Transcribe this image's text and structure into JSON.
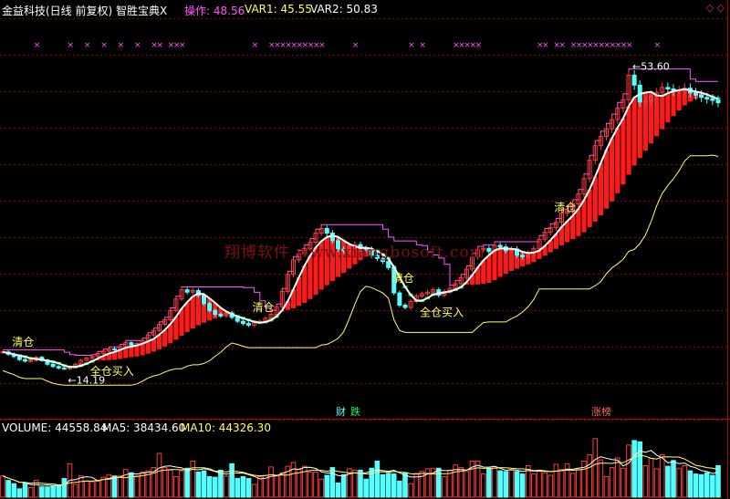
{
  "header": {
    "title": "金益科技(日线 前复权) 智胜宝典X",
    "op_label": "操作: 48.56",
    "var1_label": "VAR1: 45.55",
    "var2_label": "VAR2: 50.83",
    "corner_icons": "◇ ◇"
  },
  "watermark": "翔博软件 www.xiangbosoft.com",
  "volume_header": {
    "volume": "VOLUME: 44558.84",
    "ma5": "MA5: 38434.60",
    "ma10": "MA10: 44326.30"
  },
  "annotations": {
    "high": "53.60",
    "low": "14.19",
    "buy": "全仓买入",
    "clear": "清仓"
  },
  "event_badges": [
    "财",
    "跌",
    "涨榜"
  ],
  "colors": {
    "up": "#ff3c3c",
    "down": "#54ffff",
    "ma_white": "#ffffff",
    "support_yellow": "#ffff66",
    "resistance_magenta": "#ff55ff",
    "band_red": "#ff1a1a",
    "green_signal": "#00cc44",
    "ma10_yellow": "#ffff66",
    "grid": "#8b0000"
  },
  "chart_data": {
    "type": "candlestick",
    "price_close": [
      17.5,
      17.2,
      16.9,
      16.5,
      16.3,
      16.4,
      16.8,
      16.4,
      15.9,
      15.6,
      15.4,
      15.3,
      15.5,
      15.9,
      16.4,
      16.7,
      16.9,
      17.3,
      17.6,
      17.9,
      17.8,
      18.2,
      18.7,
      18.4,
      18.6,
      19.0,
      19.7,
      20.3,
      21.1,
      21.7,
      22.9,
      24.4,
      25.6,
      25.3,
      25.5,
      24.9,
      23.8,
      22.9,
      22.4,
      22.2,
      22.6,
      22.0,
      21.5,
      21.2,
      21.0,
      21.4,
      21.5,
      21.9,
      22.4,
      23.4,
      25.4,
      27.6,
      29.5,
      30.3,
      31.0,
      31.8,
      33.0,
      33.6,
      33.0,
      32.0,
      30.9,
      30.7,
      31.3,
      31.5,
      31.0,
      30.9,
      30.1,
      29.7,
      29.3,
      28.5,
      25.2,
      23.6,
      23.3,
      24.1,
      24.8,
      25.1,
      25.3,
      25.6,
      24.9,
      25.4,
      25.8,
      26.4,
      27.2,
      28.3,
      29.9,
      30.8,
      31.0,
      30.6,
      31.4,
      31.2,
      30.7,
      30.9,
      30.1,
      29.9,
      30.4,
      31.0,
      32.2,
      33.1,
      33.7,
      34.4,
      35.6,
      35.9,
      36.8,
      38.1,
      40.1,
      42.5,
      44.4,
      45.6,
      46.6,
      47.8,
      49.3,
      50.4,
      53.6,
      52.3,
      50.1,
      50.2,
      50.9,
      51.3,
      52.0,
      51.8,
      51.5,
      51.6,
      51.9,
      51.3,
      51.0,
      50.7,
      50.5,
      50.3,
      50.0
    ],
    "volume": [
      3.3,
      2.6,
      2.1,
      1.3,
      2.2,
      1.5,
      2.6,
      1.6,
      1.6,
      1.7,
      1.8,
      2.9,
      5.2,
      2.0,
      3.3,
      2.5,
      2.4,
      2.5,
      3.1,
      3.5,
      3.3,
      3.3,
      4.3,
      3.8,
      3.3,
      3.9,
      4.1,
      4.6,
      6.8,
      4.6,
      4.2,
      3.2,
      4.1,
      4.5,
      5.6,
      3.9,
      4.1,
      3.2,
      3.1,
      4.2,
      3.3,
      5.2,
      2.9,
      3.2,
      2.9,
      2.0,
      3.2,
      3.4,
      4.7,
      3.3,
      3.8,
      4.8,
      5.4,
      4.3,
      4.8,
      3.9,
      3.9,
      2.8,
      3.4,
      4.6,
      2.2,
      3.5,
      4.4,
      4.2,
      4.2,
      2.8,
      4.5,
      5.6,
      3.5,
      3.7,
      3.6,
      2.5,
      3.8,
      2.1,
      3.7,
      4.0,
      4.4,
      4.5,
      4.5,
      3.2,
      4.2,
      5.0,
      4.6,
      4.0,
      5.6,
      5.6,
      3.6,
      4.5,
      4.7,
      4.1,
      4.0,
      4.2,
      4.0,
      3.6,
      4.9,
      3.6,
      4.2,
      3.8,
      3.4,
      5.1,
      4.3,
      5.2,
      3.7,
      4.3,
      5.6,
      6.6,
      9.1,
      5.8,
      3.2,
      4.6,
      6.1,
      4.5,
      8.1,
      8.8,
      8.6,
      4.9,
      6.0,
      4.4,
      6.6,
      4.8,
      5.7,
      4.5,
      4.9,
      4.1,
      3.6,
      3.5,
      3.8,
      3.4,
      4.9
    ],
    "vol_ymax": 9.5,
    "price_ymin": 12.0,
    "price_ymax": 56.5,
    "grid": true
  }
}
